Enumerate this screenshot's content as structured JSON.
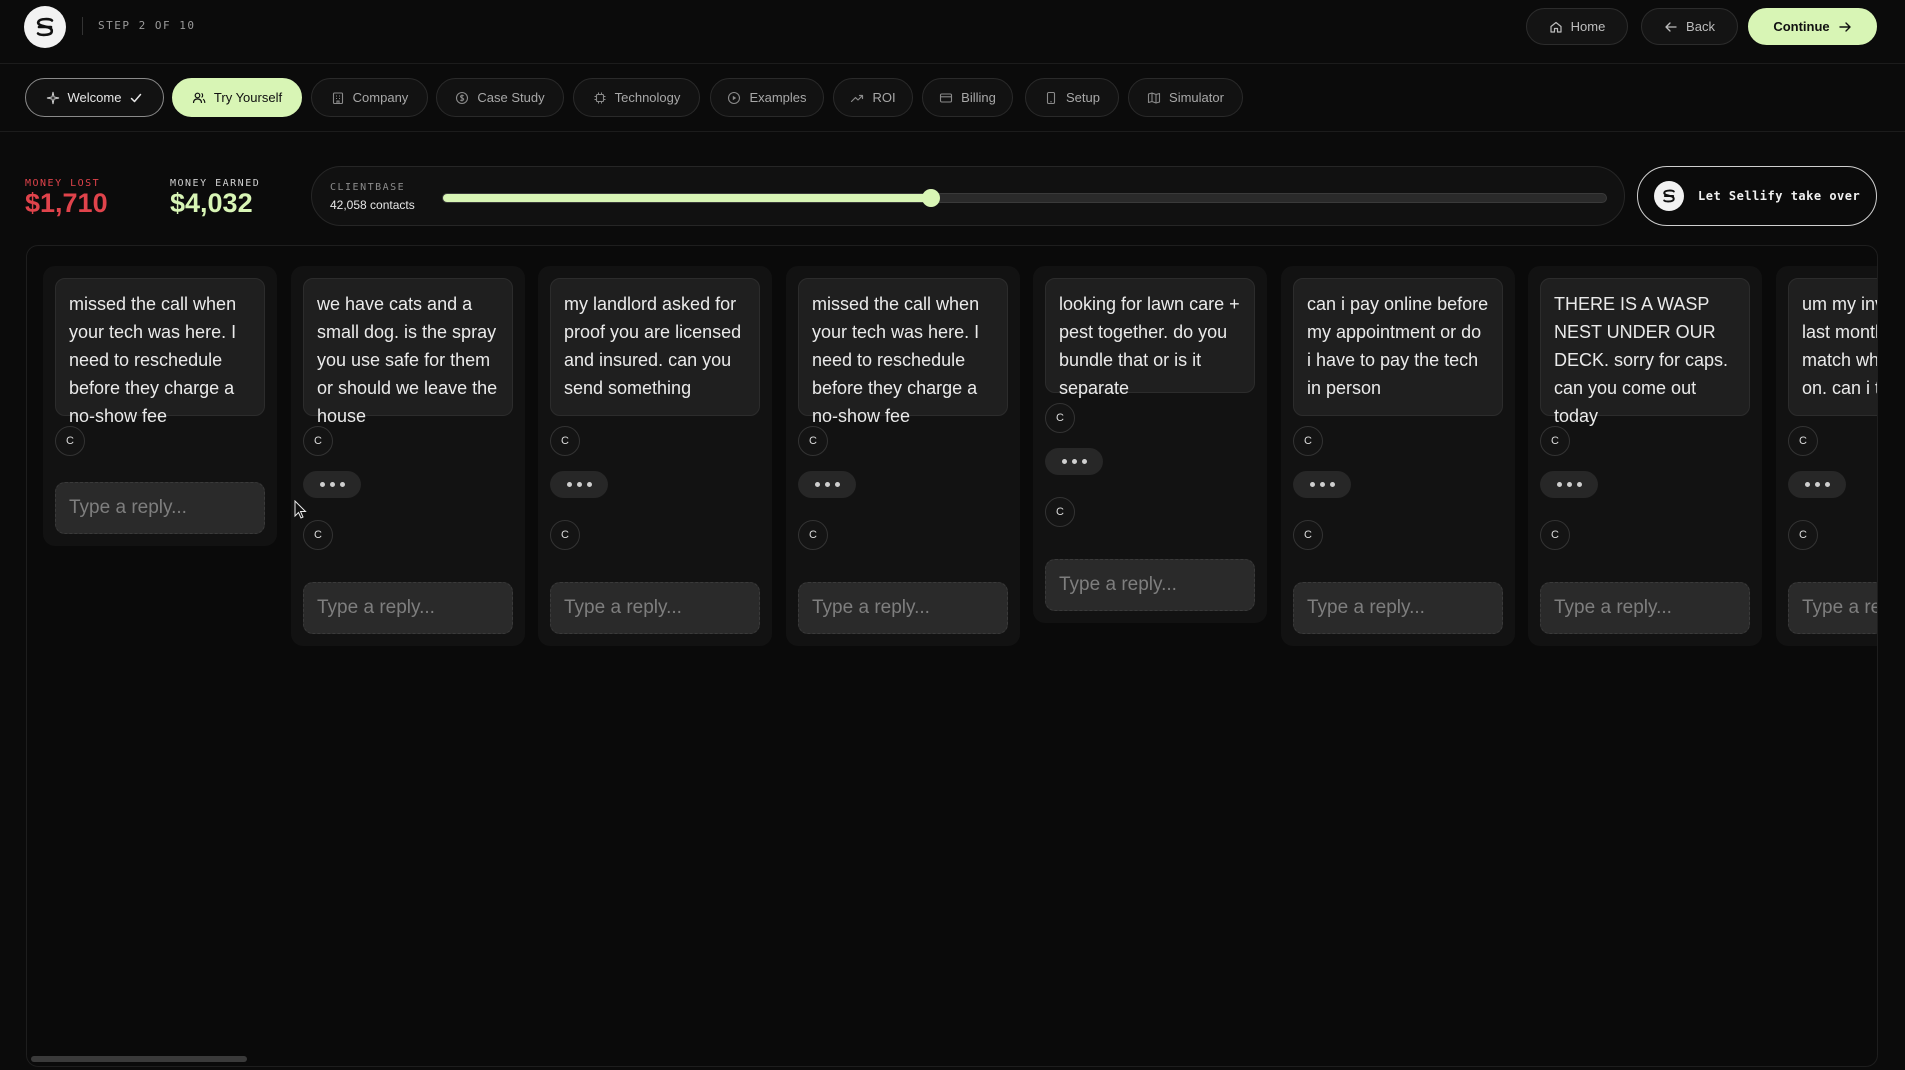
{
  "header": {
    "step_text": "STEP 2 OF 10",
    "home_label": "Home",
    "back_label": "Back",
    "continue_label": "Continue"
  },
  "tabs": [
    {
      "label": "Welcome",
      "icon": "sparkle-icon",
      "state": "done"
    },
    {
      "label": "Try Yourself",
      "icon": "users-icon",
      "state": "active"
    },
    {
      "label": "Company",
      "icon": "building-icon",
      "state": "default"
    },
    {
      "label": "Case Study",
      "icon": "coin-icon",
      "state": "default"
    },
    {
      "label": "Technology",
      "icon": "cpu-icon",
      "state": "default"
    },
    {
      "label": "Examples",
      "icon": "play-circle-icon",
      "state": "default"
    },
    {
      "label": "ROI",
      "icon": "trend-up-icon",
      "state": "default"
    },
    {
      "label": "Billing",
      "icon": "card-icon",
      "state": "default"
    },
    {
      "label": "Setup",
      "icon": "phone-icon",
      "state": "default"
    },
    {
      "label": "Simulator",
      "icon": "map-icon",
      "state": "default"
    }
  ],
  "stats": {
    "money_lost_label": "MONEY LOST",
    "money_lost_value": "$1,710",
    "money_earned_label": "MONEY EARNED",
    "money_earned_value": "$4,032"
  },
  "clientbase": {
    "label": "CLIENTBASE",
    "value": "42,058 contacts",
    "slider_fraction": 0.42
  },
  "takeover_label": "Let Sellify take over",
  "reply_placeholder": "Type a reply...",
  "avatar_initial": "C",
  "conversations": [
    {
      "message": "missed the call when your tech was here. I need to reschedule before they charge a no-show fee",
      "typing": false
    },
    {
      "message": "we have cats and a small dog. is the spray you use safe for them or should we leave the house",
      "typing": true
    },
    {
      "message": "my landlord asked for proof you are licensed and insured. can you send something",
      "typing": true
    },
    {
      "message": "missed the call when your tech was here. I need to reschedule before they charge a no-show fee",
      "typing": true
    },
    {
      "message": "looking for lawn care + pest together. do you bundle that or is it separate",
      "typing": true
    },
    {
      "message": "can i pay online before my appointment or do i have to pay the tech in person",
      "typing": true
    },
    {
      "message": "THERE IS A WASP NEST UNDER OUR DECK. sorry for caps. can you come out today",
      "typing": true
    },
    {
      "message": "um my invoice from last month doesnt match what we agreed on. can i talk to about",
      "typing": true
    }
  ],
  "colors": {
    "accent": "#d8f5b5",
    "loss": "#e0434b",
    "background": "#0b0b0b"
  }
}
